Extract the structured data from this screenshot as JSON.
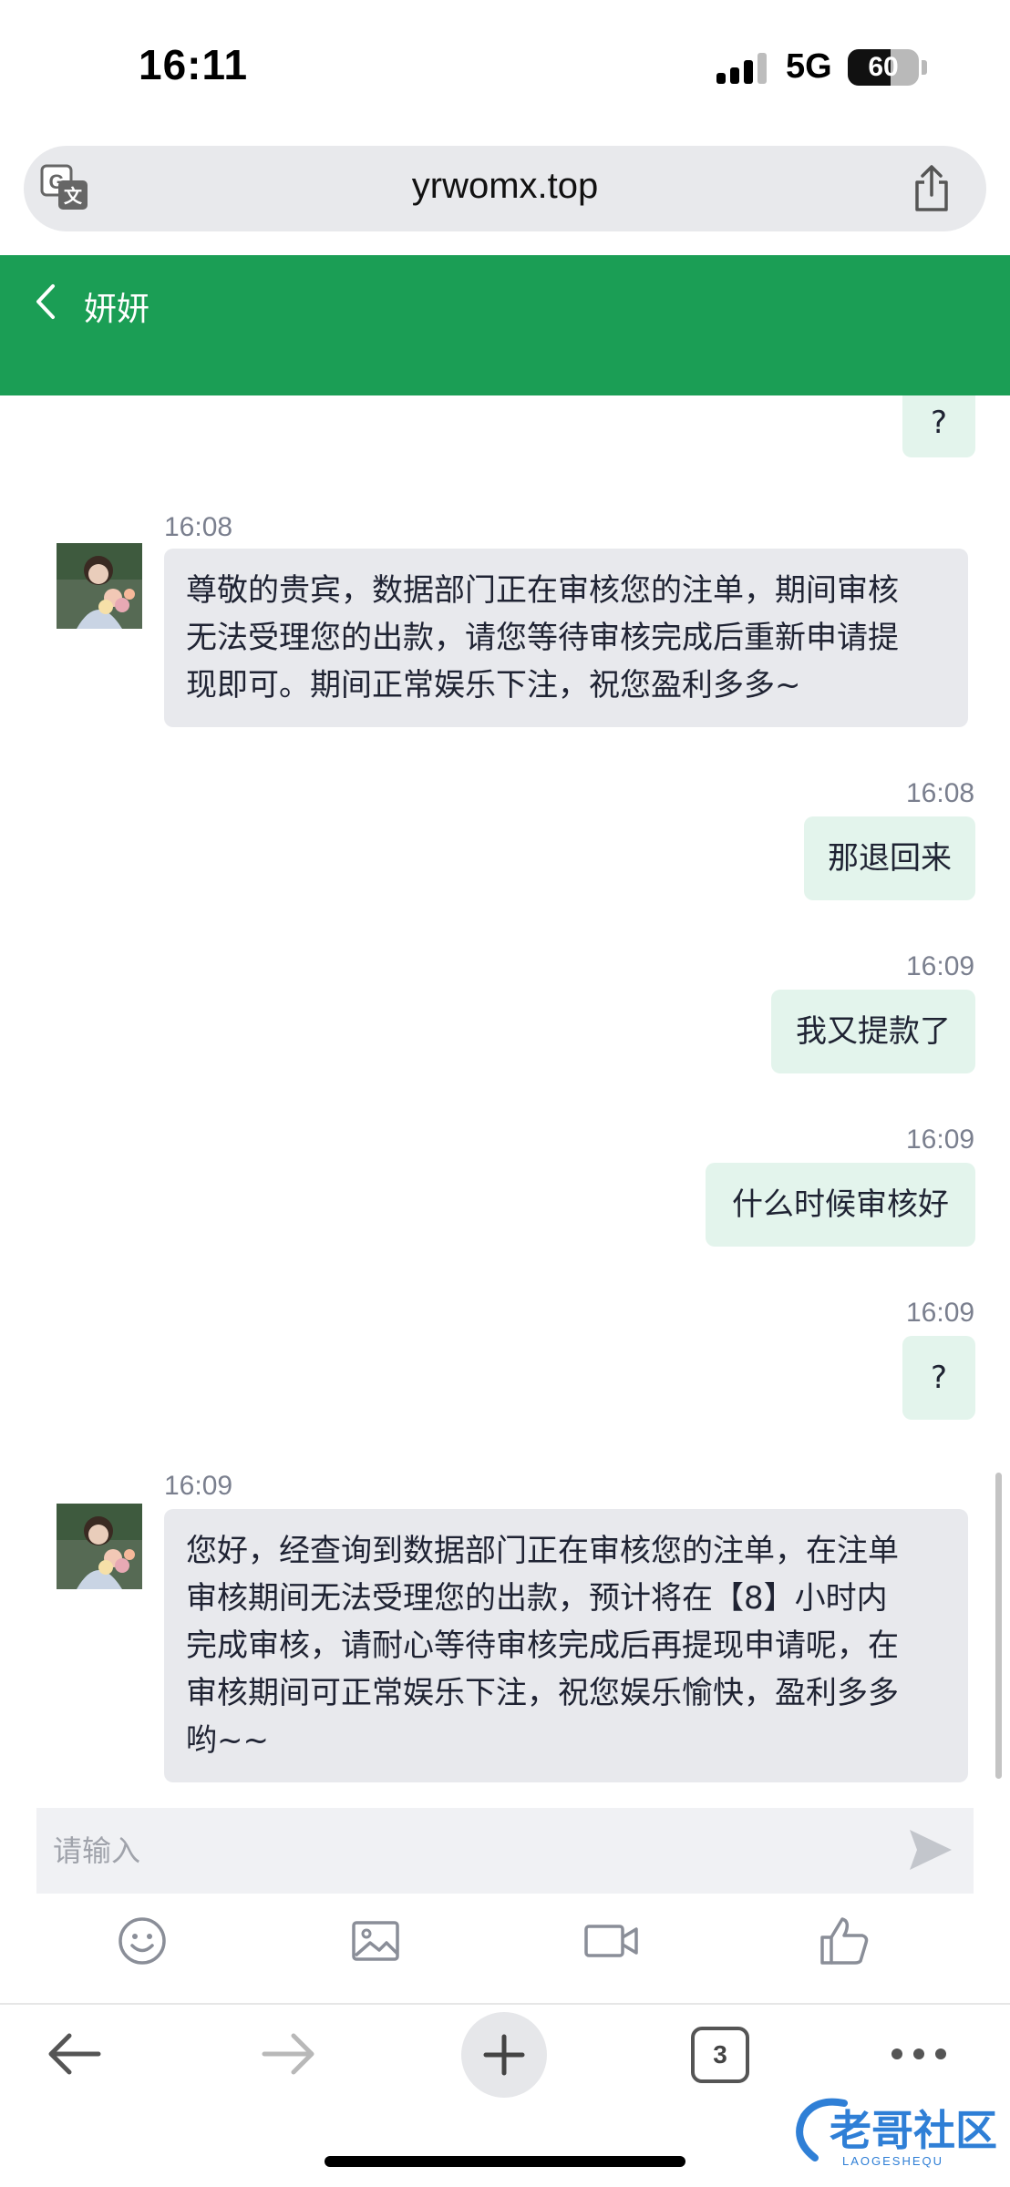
{
  "status_bar": {
    "time": "16:11",
    "network": "5G",
    "battery": "60",
    "battery_fraction": 0.6
  },
  "browser": {
    "url": "yrwomx.top",
    "open_tabs": "3",
    "icons": {
      "translate": "translate-icon",
      "share": "share-icon",
      "back": "arrow-left-icon",
      "forward": "arrow-right-icon",
      "new_tab": "plus-icon",
      "tabs": "tabs-icon",
      "more": "more-icon"
    }
  },
  "chat": {
    "header_color": "#1b9e55",
    "title": "妍妍",
    "messages": [
      {
        "direction": "out",
        "text": "?"
      },
      {
        "direction": "in",
        "time": "16:08",
        "lines": [
          "尊敬的贵宾，数据部门正在审核您的注单，期间审核",
          "无法受理您的出款，请您等待审核完成后重新申请提",
          "现即可。期间正常娱乐下注，祝您盈利多多~"
        ]
      },
      {
        "direction": "out",
        "time": "16:08",
        "text": "那退回来"
      },
      {
        "direction": "out",
        "time": "16:09",
        "text": "我又提款了"
      },
      {
        "direction": "out",
        "time": "16:09",
        "text": "什么时候审核好"
      },
      {
        "direction": "out",
        "time": "16:09",
        "text": "?"
      },
      {
        "direction": "in",
        "time": "16:09",
        "lines": [
          "您好，经查询到数据部门正在审核您的注单，在注单",
          "审核期间无法受理您的出款，预计将在【8】小时内",
          "完成审核，请耐心等待审核完成后再提现申请呢，在",
          "审核期间可正常娱乐下注，祝您娱乐愉快，盈利多多",
          "哟~~"
        ]
      }
    ],
    "input": {
      "placeholder": "请输入",
      "value": ""
    },
    "toolbar_icons": [
      "emoji-icon",
      "image-icon",
      "video-icon",
      "thumbs-up-icon",
      "send-icon"
    ]
  },
  "watermark": {
    "text": "老哥社区",
    "subtext": "LAOGESHEQU"
  }
}
